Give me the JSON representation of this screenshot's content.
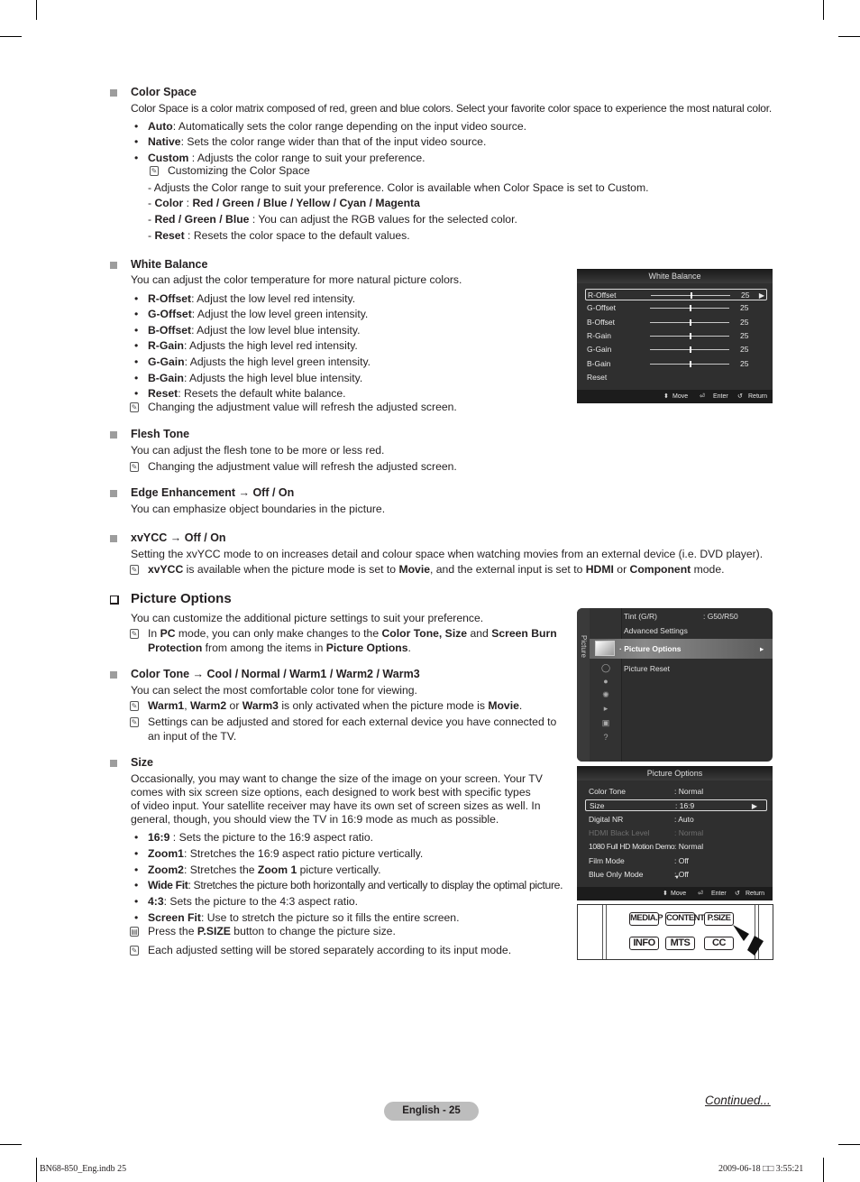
{
  "color_space": {
    "heading": "Color Space",
    "intro": "Color Space is a color matrix composed of red, green and blue colors. Select your favorite color space to experience the most natural color.",
    "bullets": [
      {
        "term": "Auto",
        "text": ": Automatically sets the color range depending on the input video source."
      },
      {
        "term": "Native",
        "text": ": Sets the color range wider than that of the input video source."
      },
      {
        "term": "Custom",
        "text": " : Adjusts the color range to suit your preference."
      }
    ],
    "custom_note": "Customizing the Color Space",
    "custom_lines": {
      "line1": "- Adjusts the Color range to suit your preference. Color is available when Color Space is set to Custom.",
      "line2_prefix": "- ",
      "line2_term": "Color",
      "line2_sep": " : ",
      "line2_values": "Red / Green / Blue / Yellow / Cyan / Magenta",
      "line3_prefix": "- ",
      "line3_term": "Red / Green / Blue",
      "line3_text": " : You can adjust the RGB values for the selected color.",
      "line4_prefix": "- ",
      "line4_term": "Reset",
      "line4_text": " : Resets the color space to the default values."
    }
  },
  "white_balance": {
    "heading": "White Balance",
    "intro": "You can adjust the color temperature for more natural picture colors.",
    "bullets": [
      {
        "term": "R-Offset",
        "text": ": Adjust the low level red intensity."
      },
      {
        "term": "G-Offset",
        "text": ": Adjust the low level green intensity."
      },
      {
        "term": "B-Offset",
        "text": ": Adjust the low level blue intensity."
      },
      {
        "term": "R-Gain",
        "text": ": Adjusts the high level red intensity."
      },
      {
        "term": "G-Gain",
        "text": ": Adjusts the high level green intensity."
      },
      {
        "term": "B-Gain",
        "text": ": Adjusts the high level blue intensity."
      },
      {
        "term": "Reset",
        "text": ": Resets the default white balance."
      }
    ],
    "note": "Changing the adjustment value will refresh the adjusted screen.",
    "osd": {
      "title": "White Balance",
      "rows": [
        {
          "label": "R-Offset",
          "value": "25",
          "level": 0.5
        },
        {
          "label": "G-Offset",
          "value": "25",
          "level": 0.5
        },
        {
          "label": "B-Offset",
          "value": "25",
          "level": 0.5
        },
        {
          "label": "R-Gain",
          "value": "25",
          "level": 0.5
        },
        {
          "label": "G-Gain",
          "value": "25",
          "level": 0.5
        },
        {
          "label": "B-Gain",
          "value": "25",
          "level": 0.5
        },
        {
          "label": "Reset"
        }
      ],
      "footer": {
        "move": "Move",
        "enter": "Enter",
        "return": "Return"
      }
    }
  },
  "flesh_tone": {
    "heading": "Flesh Tone",
    "intro": "You can adjust the flesh tone to be more or less red.",
    "note": "Changing the adjustment value will refresh the adjusted screen."
  },
  "edge_enhancement": {
    "heading": "Edge Enhancement → Off / On",
    "intro": "You can emphasize object boundaries in the picture."
  },
  "xvycc": {
    "heading": "xvYCC → Off / On",
    "intro": "Setting the xvYCC mode to on increases detail and colour space when watching movies from an external device (i.e. DVD player).",
    "note": {
      "t1": "xvYCC",
      "t2": " is available when the picture mode is set to ",
      "t3": "Movie",
      "t4": ", and the external input is set to ",
      "t5": "HDMI",
      "t6": " or ",
      "t7": "Component",
      "t8": " mode."
    }
  },
  "picture_options": {
    "heading": "Picture Options",
    "intro": "You can customize the additional picture settings to suit your preference.",
    "note": {
      "t1": "In ",
      "t2": "PC",
      "t3": " mode, you can only make changes to the ",
      "t4": "Color Tone, Size",
      "t5": " and ",
      "t6": "Screen Burn",
      "t7": "Protection",
      "t8": " from among the items in ",
      "t9": "Picture Options",
      "t10": "."
    },
    "menu": {
      "side_label": "Picture",
      "items": [
        "Tint (G/R)",
        "Advanced Settings",
        "Picture Options",
        "Picture Reset"
      ],
      "tint_value": ": G50/R50"
    },
    "osd": {
      "title": "Picture Options",
      "rows": [
        {
          "label": "Color Tone",
          "value": ": Normal"
        },
        {
          "label": "Size",
          "value": ": 16:9"
        },
        {
          "label": "Digital NR",
          "value": ": Auto"
        },
        {
          "label": "HDMI Black Level",
          "value": ": Normal"
        },
        {
          "label": "1080 Full HD Motion Demo",
          "value": ": Normal"
        },
        {
          "label": "Film Mode",
          "value": ": Off"
        },
        {
          "label": "Blue Only Mode",
          "value": ": Off"
        }
      ],
      "footer": {
        "move": "Move",
        "enter": "Enter",
        "return": "Return"
      }
    }
  },
  "color_tone": {
    "heading": "Color Tone → Cool / Normal / Warm1 / Warm2 / Warm3",
    "intro": "You can select the most comfortable color tone for viewing.",
    "note1": {
      "t1": "Warm1",
      "t2": ", ",
      "t3": "Warm2",
      "t4": " or ",
      "t5": "Warm3",
      "t6": "  is only activated when the picture mode is ",
      "t7": "Movie",
      "t8": "."
    },
    "note2_l1": "Settings can be adjusted and stored for each external device you have connected to",
    "note2_l2": "an input of the TV."
  },
  "size": {
    "heading": "Size",
    "para": [
      "Occasionally, you may want to change the size of the image on your screen. Your TV",
      "comes with six screen size options, each designed to work best with specific types",
      "of video input. Your satellite receiver may have its own set of screen sizes as well. In",
      "general, though, you should view the TV in 16:9 mode as much as possible."
    ],
    "bullets": [
      {
        "term": "16:9",
        "text": " : Sets the picture to the 16:9 aspect ratio."
      },
      {
        "term": "Zoom1",
        "text": ": Stretches the 16:9 aspect ratio picture vertically."
      },
      {
        "term": "Zoom2",
        "text": ":  Stretches the ",
        "term2": "Zoom 1",
        "text2": " picture vertically."
      },
      {
        "term": "Wide Fit",
        "text": ": Stretches the picture both horizontally and vertically to display the optimal picture."
      },
      {
        "term": "4:3",
        "text": ": Sets the picture to the 4:3 aspect ratio."
      },
      {
        "term": "Screen Fit",
        "text": ": Use to stretch the picture so it fills the entire screen."
      }
    ],
    "remote_note": {
      "t1": "Press the ",
      "t2": "P.SIZE",
      "t3": " button to change the picture size."
    },
    "note": "Each adjusted setting will be stored separately according to its input mode.",
    "remote_buttons": [
      "MEDIA.P",
      "CONTENT",
      "P.SIZE",
      "INFO",
      "MTS",
      "CC"
    ]
  },
  "footer": {
    "page": "English - 25",
    "continued": "Continued...",
    "slug_left": "BN68-850_Eng.indb   25",
    "slug_right": "2009-06-18   □□ 3:55:21"
  }
}
